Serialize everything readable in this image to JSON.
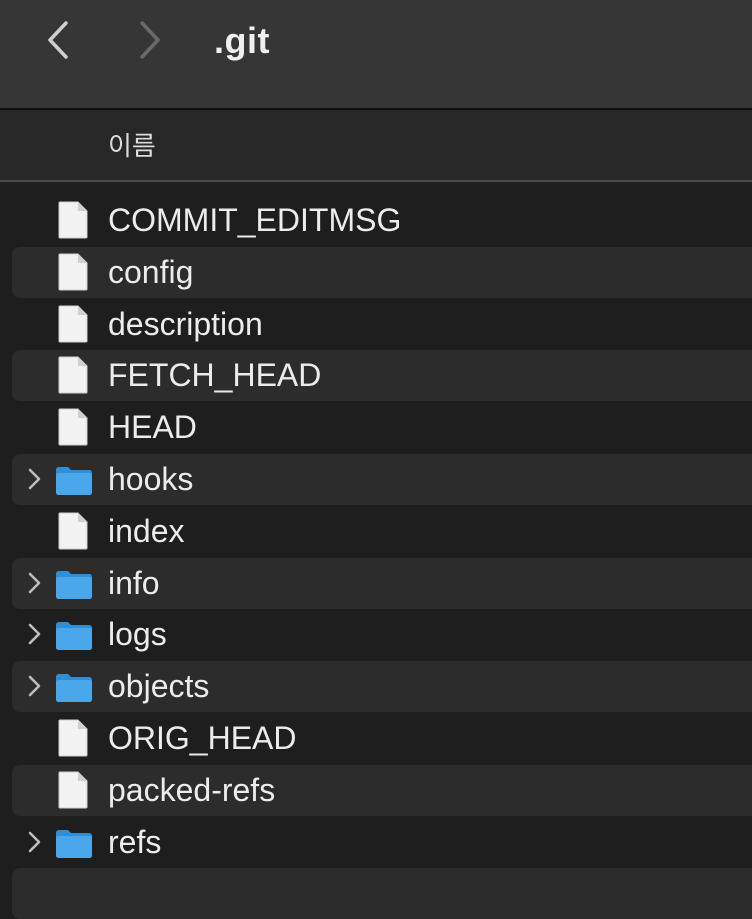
{
  "window": {
    "title": ".git"
  },
  "nav": {
    "back_icon": "chevron-left-icon",
    "forward_icon": "chevron-right-icon"
  },
  "columns": {
    "name": "이름"
  },
  "items": [
    {
      "label": "COMMIT_EDITMSG",
      "kind": "file"
    },
    {
      "label": "config",
      "kind": "file"
    },
    {
      "label": "description",
      "kind": "file"
    },
    {
      "label": "FETCH_HEAD",
      "kind": "file"
    },
    {
      "label": "HEAD",
      "kind": "file"
    },
    {
      "label": "hooks",
      "kind": "folder"
    },
    {
      "label": "index",
      "kind": "file"
    },
    {
      "label": "info",
      "kind": "folder"
    },
    {
      "label": "logs",
      "kind": "folder"
    },
    {
      "label": "objects",
      "kind": "folder"
    },
    {
      "label": "ORIG_HEAD",
      "kind": "file"
    },
    {
      "label": "packed-refs",
      "kind": "file"
    },
    {
      "label": "refs",
      "kind": "folder"
    }
  ],
  "colors": {
    "folder": "#4aa8ea",
    "file": "#f2f2f2",
    "row_alt": "#2c2c2c",
    "background": "#1e1e1e",
    "toolbar": "#363636"
  }
}
